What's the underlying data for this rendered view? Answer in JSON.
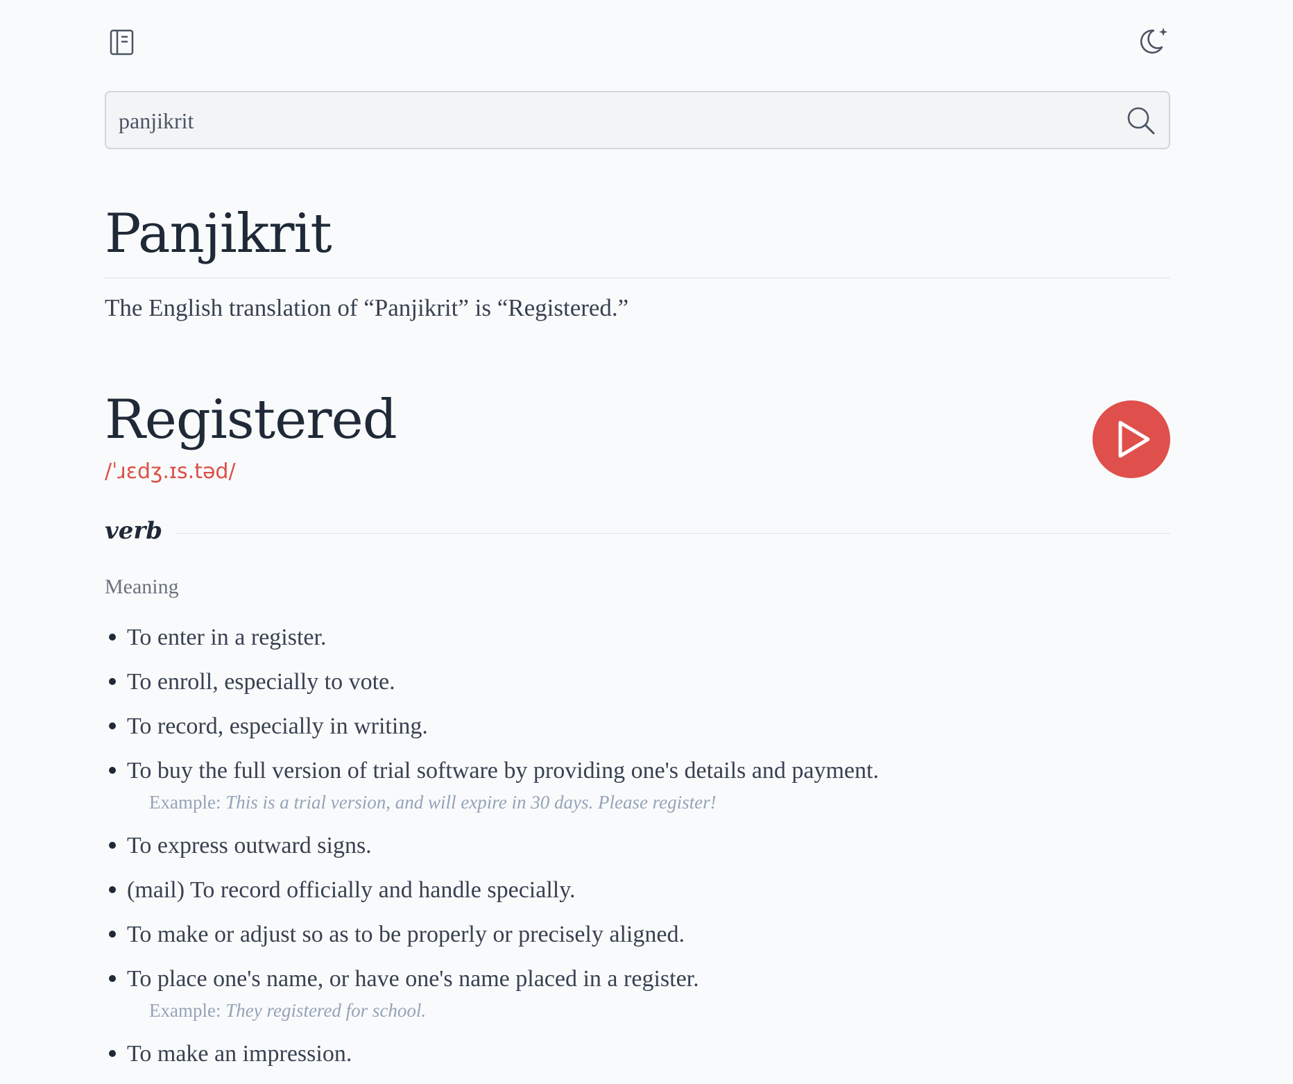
{
  "header": {
    "logo_icon": "book-icon",
    "theme_icon": "moon-star-icon"
  },
  "search": {
    "value": "panjikrit",
    "icon": "search-icon"
  },
  "entry": {
    "headword": "Panjikrit",
    "translation": "The English translation of “Panjikrit” is “Registered.”"
  },
  "word": {
    "text": "Registered",
    "phonetic": "/ˈɹɛdʒ.ɪs.təd/",
    "play_icon": "play-icon",
    "part_of_speech": "verb",
    "meaning_label": "Meaning",
    "example_label": "Example:",
    "definitions": [
      {
        "text": "To enter in a register."
      },
      {
        "text": "To enroll, especially to vote."
      },
      {
        "text": "To record, especially in writing."
      },
      {
        "text": "To buy the full version of trial software by providing one's details and payment.",
        "example": "This is a trial version, and will expire in 30 days. Please register!"
      },
      {
        "text": "To express outward signs."
      },
      {
        "text": "(mail) To record officially and handle specially."
      },
      {
        "text": "To make or adjust so as to be properly or precisely aligned."
      },
      {
        "text": "To place one's name, or have one's name placed in a register.",
        "example": "They registered for school."
      },
      {
        "text": "To make an impression."
      }
    ]
  },
  "colors": {
    "background": "#f9fafb",
    "accent": "#df4f4b",
    "text": "#1f2937",
    "muted": "#94a3b8"
  }
}
